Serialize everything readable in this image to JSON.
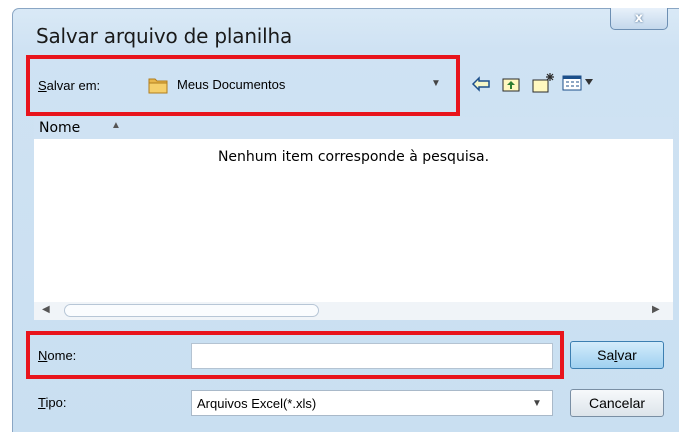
{
  "window": {
    "title": "Salvar arquivo de planilha",
    "close_label": "x"
  },
  "save_in": {
    "label_prefix": "S",
    "label_rest": "alvar em:",
    "value": "Meus Documentos"
  },
  "toolbar": {
    "icons": [
      "back-arrow-icon",
      "up-folder-icon",
      "new-folder-icon",
      "view-menu-icon"
    ]
  },
  "file_list": {
    "column_header": "Nome",
    "empty_message": "Nenhum item corresponde à pesquisa."
  },
  "file_name": {
    "label_prefix": "N",
    "label_rest": "ome:",
    "value": ""
  },
  "file_type": {
    "label_prefix": "T",
    "label_rest": "ipo:",
    "value": "Arquivos Excel(*.xls)"
  },
  "buttons": {
    "save_prefix": "Sa",
    "save_underlined": "l",
    "save_rest": "var",
    "cancel": "Cancelar"
  },
  "colors": {
    "highlight": "#e8141c",
    "accent": "#3c7fb1"
  }
}
